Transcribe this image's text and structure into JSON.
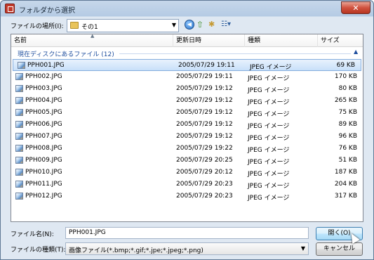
{
  "window": {
    "title": "フォルダから選択",
    "close_label": "✕"
  },
  "toolbar": {
    "location_label": "ファイルの場所(I):",
    "location_value": "その1"
  },
  "list": {
    "columns": {
      "name": "名前",
      "date": "更新日時",
      "type": "種類",
      "size": "サイズ"
    },
    "group_label": "現在ディスクにあるファイル (12)",
    "files": [
      {
        "name": "PPH001.JPG",
        "date": "2005/07/29 19:11",
        "type": "JPEG イメージ",
        "size": "69 KB",
        "selected": true
      },
      {
        "name": "PPH002.JPG",
        "date": "2005/07/29 19:11",
        "type": "JPEG イメージ",
        "size": "170 KB"
      },
      {
        "name": "PPH003.JPG",
        "date": "2005/07/29 19:12",
        "type": "JPEG イメージ",
        "size": "80 KB"
      },
      {
        "name": "PPH004.JPG",
        "date": "2005/07/29 19:12",
        "type": "JPEG イメージ",
        "size": "265 KB"
      },
      {
        "name": "PPH005.JPG",
        "date": "2005/07/29 19:12",
        "type": "JPEG イメージ",
        "size": "75 KB"
      },
      {
        "name": "PPH006.JPG",
        "date": "2005/07/29 19:12",
        "type": "JPEG イメージ",
        "size": "89 KB"
      },
      {
        "name": "PPH007.JPG",
        "date": "2005/07/29 19:12",
        "type": "JPEG イメージ",
        "size": "96 KB"
      },
      {
        "name": "PPH008.JPG",
        "date": "2005/07/29 19:22",
        "type": "JPEG イメージ",
        "size": "76 KB"
      },
      {
        "name": "PPH009.JPG",
        "date": "2005/07/29 20:25",
        "type": "JPEG イメージ",
        "size": "51 KB"
      },
      {
        "name": "PPH010.JPG",
        "date": "2005/07/29 20:12",
        "type": "JPEG イメージ",
        "size": "187 KB"
      },
      {
        "name": "PPH011.JPG",
        "date": "2005/07/29 20:23",
        "type": "JPEG イメージ",
        "size": "204 KB"
      },
      {
        "name": "PPH012.JPG",
        "date": "2005/07/29 20:23",
        "type": "JPEG イメージ",
        "size": "317 KB"
      }
    ]
  },
  "footer": {
    "filename_label": "ファイル名(N):",
    "filename_value": "PPH001.JPG",
    "filetype_label": "ファイルの種類(T):",
    "filetype_value": "画像ファイル(*.bmp;*.gif;*.jpe;*.jpeg;*.png)",
    "open_label": "開く(O)",
    "cancel_label": "キャンセル"
  },
  "icons": {
    "back": "back-arrow-icon",
    "up": "up-folder-icon",
    "new_folder": "new-folder-icon",
    "views": "views-menu-icon"
  },
  "colors": {
    "selection": "#c8e0f9",
    "group_text": "#1e4e9e",
    "close_button": "#d0523f"
  }
}
